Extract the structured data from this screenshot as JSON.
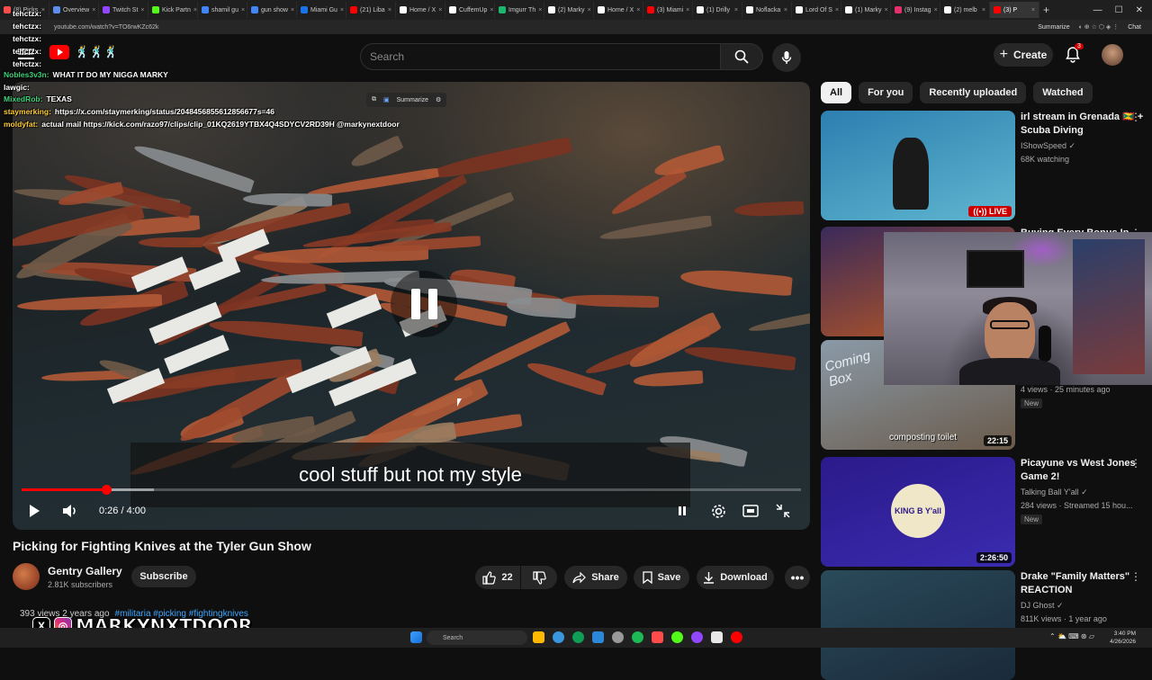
{
  "browser": {
    "tabs": [
      {
        "label": "(8) Picks",
        "color": "#ff4d4d"
      },
      {
        "label": "Overview",
        "color": "#5b8def"
      },
      {
        "label": "Twitch St",
        "color": "#9146ff"
      },
      {
        "label": "Kick Partn",
        "color": "#53fc18"
      },
      {
        "label": "shamil gu",
        "color": "#4285f4"
      },
      {
        "label": "gun show",
        "color": "#4285f4"
      },
      {
        "label": "Miami Gu",
        "color": "#1a73e8"
      },
      {
        "label": "(21) Liba",
        "color": "#ff0000"
      },
      {
        "label": "Home / X",
        "color": "#ffffff"
      },
      {
        "label": "CuffemUp",
        "color": "#ffffff"
      },
      {
        "label": "Imgurr Th",
        "color": "#1bb76e"
      },
      {
        "label": "(2) Marky",
        "color": "#ffffff"
      },
      {
        "label": "Home / X",
        "color": "#ffffff"
      },
      {
        "label": "(3) Miami",
        "color": "#ff0000"
      },
      {
        "label": "(1) Drilly",
        "color": "#ffffff"
      },
      {
        "label": "Noflacka",
        "color": "#ffffff"
      },
      {
        "label": "Lord Of S",
        "color": "#ffffff"
      },
      {
        "label": "(1) Marky",
        "color": "#ffffff"
      },
      {
        "label": "(9) Instag",
        "color": "#e1306c"
      },
      {
        "label": "(2) melb",
        "color": "#ffffff"
      },
      {
        "label": "(3) P",
        "color": "#ff0000",
        "active": true
      }
    ],
    "url": "youtube.com/watch?v=TO6rwKZc62k",
    "summarize_label": "Summarize",
    "chat_label": "Chat"
  },
  "chat": [
    {
      "user": "tehctzx:",
      "msg": "",
      "color": "#ffffff"
    },
    {
      "user": "tehctzx:",
      "msg": "",
      "color": "#ffffff"
    },
    {
      "user": "tehctzx:",
      "msg": "",
      "color": "#ffffff"
    },
    {
      "user": "tehctzx:",
      "msg": "",
      "color": "#ffffff"
    },
    {
      "user": "tehctzx:",
      "msg": "",
      "color": "#ffffff"
    },
    {
      "user": "Nobles3v3n:",
      "msg": "WHAT IT DO MY NIGGA MARKY",
      "color": "#3fd27a"
    },
    {
      "user": "lawgic:",
      "msg": "",
      "color": "#ffffff"
    },
    {
      "user": "MixedRob:",
      "msg": "TEXAS",
      "color": "#3fd27a"
    },
    {
      "user": "staymerking:",
      "msg": "https://x.com/staymerking/status/2048456855612856677s=46",
      "color": "#ffcc33"
    },
    {
      "user": "moldyfat:",
      "msg": "actual mail https://kick.com/razo97/clips/clip_01KQ2619YTBX4Q4SDYCV2RD39H @markynextdoor",
      "color": "#ffcc33"
    }
  ],
  "header": {
    "search_placeholder": "Search",
    "create_label": "Create",
    "notif_count": "3"
  },
  "player": {
    "caption": "cool stuff but not my style",
    "time": "0:26 / 4:00",
    "progress": 0.108,
    "buffered": 0.17,
    "summarize_chip": "Summarize"
  },
  "video": {
    "title": "Picking for Fighting Knives at the Tyler Gun Show",
    "channel": "Gentry Gallery",
    "subscribers": "2.81K subscribers",
    "subscribe_label": "Subscribe",
    "likes": "22",
    "share_label": "Share",
    "save_label": "Save",
    "download_label": "Download",
    "views_date": "393 views  2 years ago",
    "hashtags": "#militaria #picking #fightingknives"
  },
  "streamer_badge": "MARKYNXTDOOR",
  "filters": [
    "All",
    "For you",
    "Recently uploaded",
    "Watched"
  ],
  "recommendations": [
    {
      "title": "irl stream in Grenada 🇬🇩 + Scuba Diving",
      "channel": "IShowSpeed",
      "meta": "68K watching",
      "badge": "LIVE",
      "thumb": [
        "#2c7fb0",
        "#5fb6cf"
      ]
    },
    {
      "title": "Buying Every Bonus In...",
      "channel": "",
      "meta": "",
      "badge": "",
      "thumb": [
        "#3a2a5a",
        "#c05a20"
      ]
    },
    {
      "title": "",
      "channel": "",
      "meta": "4 views · 25 minutes ago",
      "newtag": "New",
      "badge": "22:15",
      "thumb": [
        "#8a9aa8",
        "#6a5a4a"
      ]
    },
    {
      "title": "Picayune vs West Jones Game 2!",
      "channel": "Talking Ball Y'all",
      "meta": "284 views · Streamed 15 hou...",
      "newtag": "New",
      "badge": "2:26:50",
      "thumb": [
        "#2a1a8a",
        "#3b2bb0"
      ]
    },
    {
      "title": "Drake \"Family Matters\" REACTION",
      "channel": "DJ Ghost",
      "meta": "811K views · 1 year ago",
      "badge": "",
      "thumb": [
        "#2a4a5a",
        "#1a2a3a"
      ]
    }
  ],
  "thumb_texts": {
    "composting": "composting toilet",
    "coming": "Coming Box",
    "kingb": "KING B Y'all"
  },
  "taskbar": {
    "search_label": "Search",
    "time": "3:40 PM",
    "date": "4/26/2026"
  }
}
